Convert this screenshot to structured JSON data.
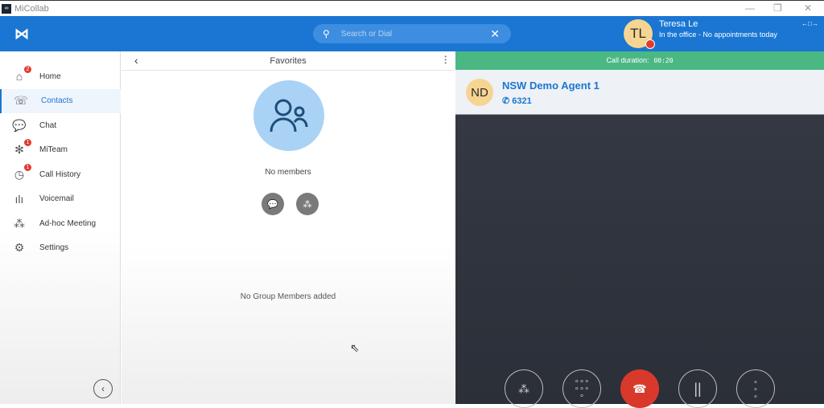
{
  "window": {
    "title": "MiCollab",
    "minimize": "—",
    "restore": "❐",
    "close": "✕"
  },
  "header": {
    "search_placeholder": "Search or Dial",
    "search_clear": "✕",
    "user": {
      "initials": "TL",
      "name": "Teresa Le",
      "status": "In the office - No appointments today",
      "presence_color": "#e33b2e"
    },
    "arrows": "←□→"
  },
  "sidebar": {
    "items": [
      {
        "label": "Home",
        "icon": "home-icon",
        "glyph": "⌂",
        "badge": "2"
      },
      {
        "label": "Contacts",
        "icon": "contacts-icon",
        "glyph": "☏",
        "active": true
      },
      {
        "label": "Chat",
        "icon": "chat-icon",
        "glyph": "💬"
      },
      {
        "label": "MiTeam",
        "icon": "miteam-icon",
        "glyph": "✻",
        "badge": "1"
      },
      {
        "label": "Call History",
        "icon": "clock-icon",
        "glyph": "◷",
        "badge": "1"
      },
      {
        "label": "Voicemail",
        "icon": "voicemail-icon",
        "glyph": "ılı"
      },
      {
        "label": "Ad-hoc Meeting",
        "icon": "meeting-icon",
        "glyph": "⁂"
      },
      {
        "label": "Settings",
        "icon": "gear-icon",
        "glyph": "⚙"
      }
    ],
    "collapse": "‹"
  },
  "favorites": {
    "title": "Favorites",
    "back": "‹",
    "no_members": "No members",
    "no_group": "No Group Members added"
  },
  "call": {
    "duration_label": "Call duration:",
    "duration": "00:20",
    "contact": {
      "initials": "ND",
      "name": "NSW Demo Agent 1",
      "number": "6321"
    }
  },
  "colors": {
    "brand": "#1a76d2",
    "call_bar": "#4bb884",
    "end_call": "#d9392b"
  }
}
